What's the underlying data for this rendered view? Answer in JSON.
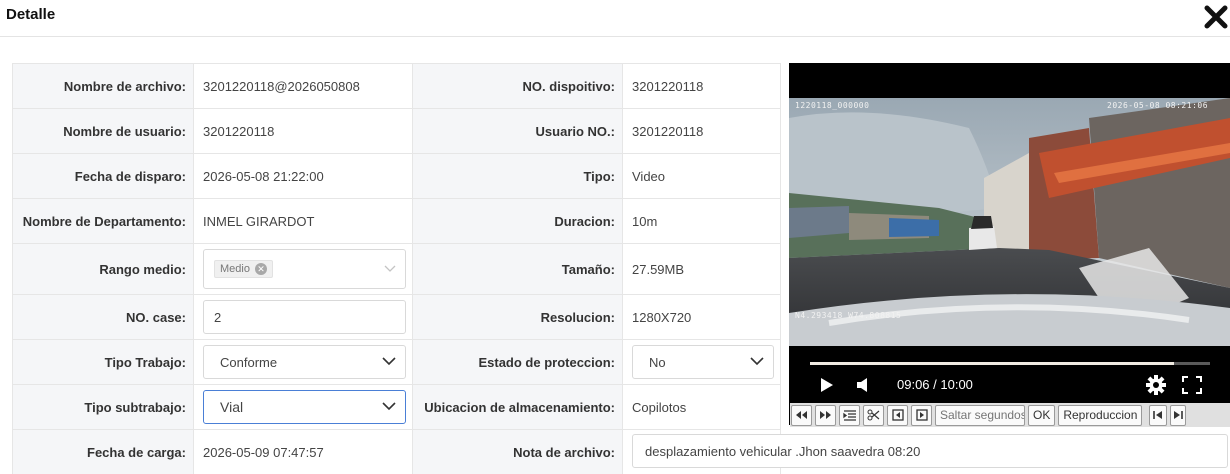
{
  "header": {
    "title": "Detalle"
  },
  "fields": {
    "nombre_archivo": {
      "label": "Nombre de archivo:",
      "value": "3201220118@2026050808"
    },
    "no_dispositivo": {
      "label": "NO. dispoitivo:",
      "value": "3201220118"
    },
    "nombre_usuario": {
      "label": "Nombre de usuario:",
      "value": "3201220118"
    },
    "usuario_no": {
      "label": "Usuario NO.:",
      "value": "3201220118"
    },
    "fecha_disparo": {
      "label": "Fecha de disparo:",
      "value": "2026-05-08 21:22:00"
    },
    "tipo": {
      "label": "Tipo:",
      "value": "Video"
    },
    "departamento": {
      "label": "Nombre de Departamento:",
      "value": "INMEL GIRARDOT"
    },
    "duracion": {
      "label": "Duracion:",
      "value": "10m"
    },
    "rango_medio": {
      "label": "Rango medio:",
      "tag": "Medio"
    },
    "tamano": {
      "label": "Tamaño:",
      "value": "27.59MB"
    },
    "no_case": {
      "label": "NO. case:",
      "value": "2"
    },
    "resolucion": {
      "label": "Resolucion:",
      "value": "1280X720"
    },
    "tipo_trabajo": {
      "label": "Tipo Trabajo:",
      "value": "Conforme"
    },
    "estado_proteccion": {
      "label": "Estado de proteccion:",
      "value": "No"
    },
    "tipo_subtrabajo": {
      "label": "Tipo subtrabajo:",
      "value": "Vial"
    },
    "ubicacion": {
      "label": "Ubicacion de almacenamiento:",
      "value": "Copilotos"
    },
    "fecha_carga": {
      "label": "Fecha de carga:",
      "value": "2026-05-09 07:47:57"
    },
    "nota": {
      "label": "Nota de archivo:",
      "value": "desplazamiento vehicular .Jhon saavedra 08:20"
    }
  },
  "player": {
    "osd_top_left": "1220118_000000",
    "osd_top_right": "2026-05-08 08:21:06",
    "osd_gps": "N4.293418 W74.808815",
    "time": "09:06 / 10:00",
    "progress": 0.91,
    "skip_placeholder": "Saltar segundos",
    "ok_label": "OK",
    "play_label": "Reproduccion"
  },
  "icons": [
    "close-icon",
    "play-icon",
    "volume-icon",
    "gear-icon",
    "fullscreen-icon",
    "rewind-icon",
    "fast-forward-icon",
    "list-icon",
    "scissors-icon",
    "prev-frame-icon",
    "next-frame-icon",
    "skip-start-icon",
    "skip-end-icon",
    "chevron-down-icon"
  ]
}
